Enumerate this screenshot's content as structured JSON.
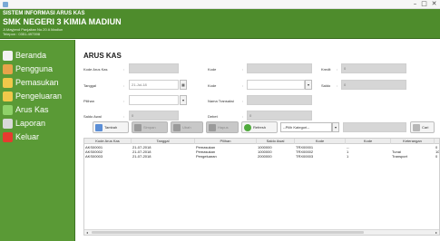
{
  "window": {
    "minimize": "–",
    "maximize": "□",
    "close": "✕"
  },
  "header": {
    "line1": "SISTEM INFORMASI ARUS KAS",
    "line2": "SMK NEGERI 3 KIMIA MADIUN",
    "line3": "Jl.Mayjend  Panjaitan No.20 A Madiun",
    "line4": "Telepon : 0351-497398"
  },
  "sidebar": {
    "items": [
      {
        "label": "Beranda",
        "icon": "home-icon",
        "color": "#f2f2f2"
      },
      {
        "label": "Pengguna",
        "icon": "users-icon",
        "color": "#e8a44a"
      },
      {
        "label": "Pemasukan",
        "icon": "folder-icon",
        "color": "#f0c84a"
      },
      {
        "label": "Pengeluaran",
        "icon": "folder-icon",
        "color": "#f0c84a"
      },
      {
        "label": "Arus Kas",
        "icon": "refresh-icon",
        "color": "#8fd16a"
      },
      {
        "label": "Laporan",
        "icon": "report-icon",
        "color": "#d9d9d9"
      },
      {
        "label": "Keluar",
        "icon": "close-icon",
        "color": "#e53b2f"
      }
    ]
  },
  "main": {
    "title": "ARUS KAS"
  },
  "form": {
    "kode_arus_kas": {
      "label": "Kode Arus Kas",
      "value": ""
    },
    "tanggal": {
      "label": "Tanggal",
      "value": "21-Jul-18"
    },
    "pilihan": {
      "label": "Pilihan",
      "value": ""
    },
    "saldo_awal": {
      "label": "Saldo Awal",
      "value": "0"
    },
    "kode1": {
      "label": "Kode",
      "value": ""
    },
    "kode2": {
      "label": "Kode",
      "value": ""
    },
    "nama_transaksi": {
      "label": "Nama Transaksi",
      "value": ""
    },
    "debet": {
      "label": "Debet",
      "value": "0"
    },
    "kredit": {
      "label": "Kredit",
      "value": "0"
    },
    "saldo": {
      "label": "Saldo",
      "value": "0"
    },
    "colon": ":",
    "dropdown_arrow": "▾",
    "calendar_icon": "▦"
  },
  "toolbar": {
    "tambah": "Tambah",
    "simpan": "Simpan",
    "ubah": "Ubah",
    "hapus": "Hapus",
    "refresh": "Refresh",
    "kategori": "--Pilih Kategori--",
    "cari_label": "Cari",
    "search_value": ""
  },
  "table": {
    "columns": [
      "Kode Arus Kas",
      "Tanggal",
      "Pilihan",
      "Saldo Awal",
      "Kode",
      "Kode",
      "Keterangan",
      ""
    ],
    "rows": [
      [
        "AKS00001",
        "21-07-2018",
        "Pemasukan",
        "1000000",
        "TRX00001",
        "--",
        "",
        "0"
      ],
      [
        "AKS00002",
        "21-07-2018",
        "Pemasukan",
        "1000000",
        "TRX00002",
        "1",
        "Tunai",
        "100000"
      ],
      [
        "AKS00003",
        "21-07-2018",
        "Pengeluaran",
        "2000000",
        "TRX00003",
        "1",
        "Transport",
        "0"
      ]
    ],
    "scroll_left": "◂",
    "scroll_right": "▸"
  }
}
